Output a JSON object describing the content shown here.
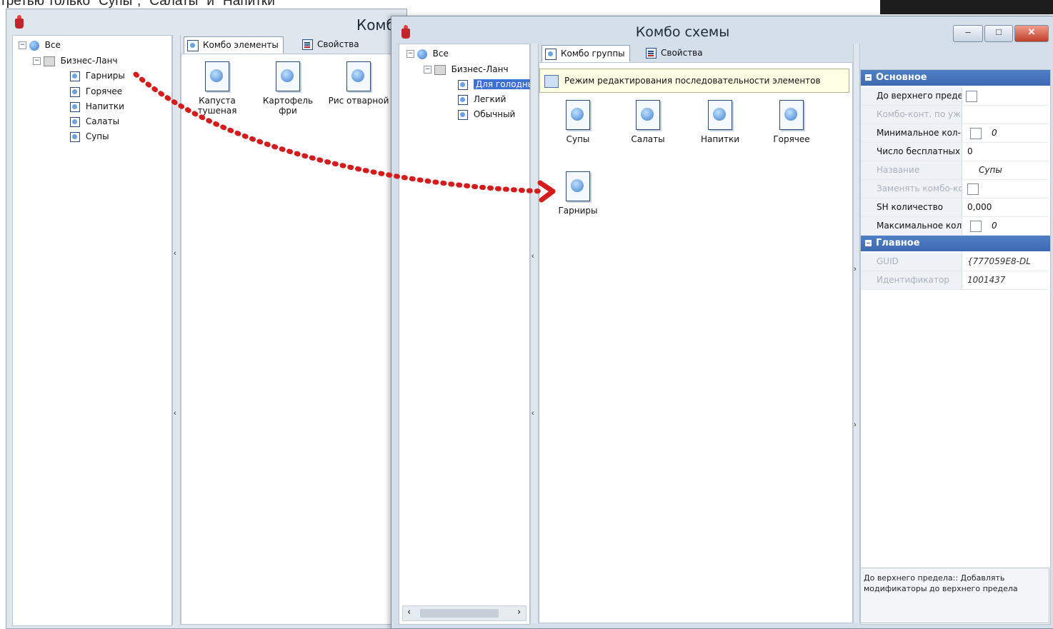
{
  "caption": "третью только \"Супы\", \"Салаты\" и \"Напитки\"",
  "back_window": {
    "title": "Комб",
    "tree": {
      "root": "Все",
      "group": "Бизнес-Ланч",
      "items": [
        "Гарниры",
        "Горячее",
        "Напитки",
        "Салаты",
        "Супы"
      ]
    },
    "tabs": {
      "active": "Комбо элементы",
      "other": "Свойства"
    },
    "items": [
      {
        "label": "Капуста тушеная"
      },
      {
        "label": "Картофель фри"
      },
      {
        "label": "Рис отварной"
      }
    ],
    "collapse_arrow": "‹"
  },
  "front_window": {
    "title": "Комбо схемы",
    "buttons": {
      "minimize": "–",
      "maximize": "□",
      "close": "✕"
    },
    "tree": {
      "root": "Все",
      "group": "Бизнес-Ланч",
      "items": [
        "Для голодных",
        "Легкий",
        "Обычный"
      ],
      "selected": "Для голодных"
    },
    "scroll_left": "‹",
    "scroll_right": "›",
    "tabs": {
      "active": "Комбо группы",
      "other": "Свойства"
    },
    "tooltip": "Режим редактирования последовательности элементов",
    "groups": [
      {
        "label": "Супы"
      },
      {
        "label": "Салаты"
      },
      {
        "label": "Напитки"
      },
      {
        "label": "Горячее"
      },
      {
        "label": "Гарниры"
      }
    ],
    "collapse_arrow": "‹",
    "expand_arrow": "›",
    "properties": {
      "section_main": "Основное",
      "rows": [
        {
          "name": "До верхнего предела",
          "value": "",
          "checkbox": true,
          "dim": false
        },
        {
          "name": "Комбо-конт. по уже",
          "value": "",
          "checkbox": false,
          "dim": true
        },
        {
          "name": "Минимальное кол-во",
          "value": "0",
          "checkbox": true,
          "dim": false,
          "italic": true
        },
        {
          "name": "Число бесплатных",
          "value": "0",
          "checkbox": false,
          "dim": false
        },
        {
          "name": "Название",
          "value": "Супы",
          "checkbox": false,
          "dim": true,
          "italic": true
        },
        {
          "name": "Заменять комбо-ко",
          "value": "",
          "checkbox": true,
          "dim": true
        },
        {
          "name": "SH количество",
          "value": "0,000",
          "checkbox": false,
          "dim": false
        },
        {
          "name": "Максимальное кол",
          "value": "0",
          "checkbox": true,
          "dim": false,
          "italic": true
        }
      ],
      "section_general": "Главное",
      "general_rows": [
        {
          "name": "GUID",
          "value": "{777059E8-DL",
          "dim": true,
          "italic": true
        },
        {
          "name": "Идентификатор",
          "value": "1001437",
          "dim": true,
          "italic": true
        }
      ],
      "description": "До верхнего предела:: Добавлять модификаторы до верхнего предела"
    }
  },
  "colors": {
    "arrow": "#d41c1c",
    "selection": "#3d6fd4",
    "section": "#3d6ab0"
  }
}
